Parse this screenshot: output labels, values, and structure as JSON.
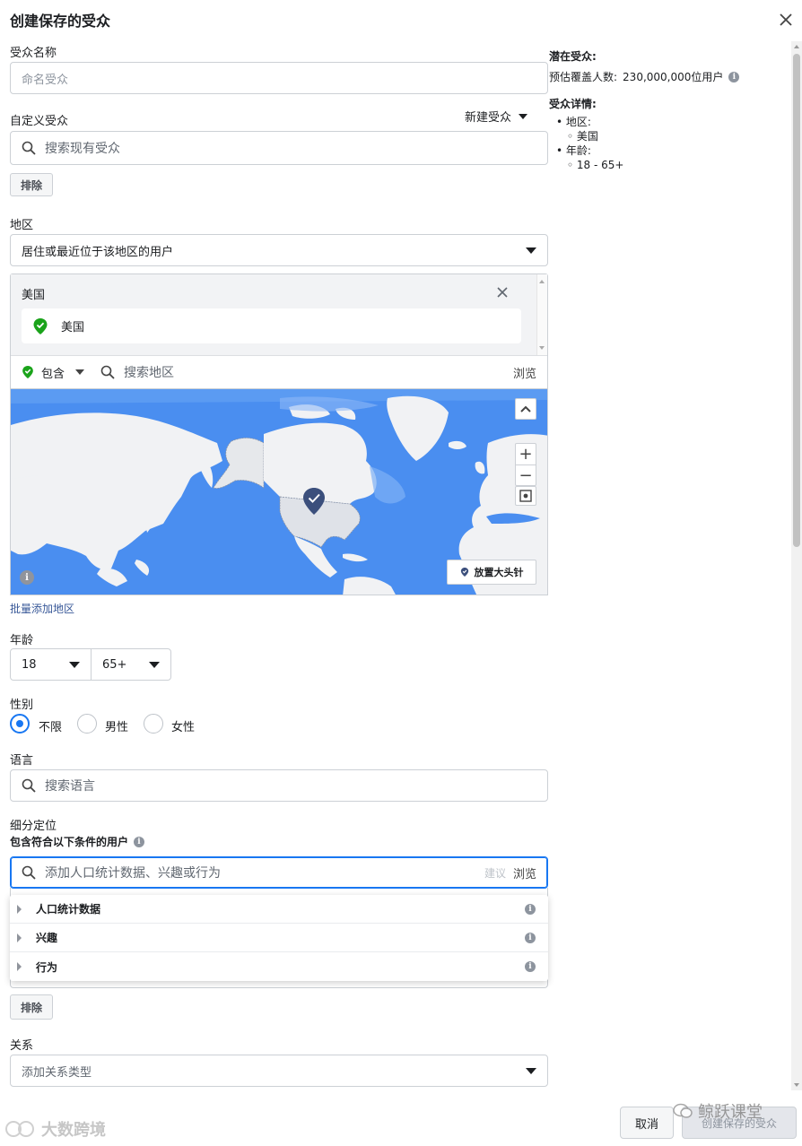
{
  "dialog": {
    "title": "创建保存的受众"
  },
  "audience_name": {
    "label": "受众名称",
    "placeholder": "命名受众"
  },
  "custom_audience": {
    "label": "自定义受众",
    "new_audience": "新建受众",
    "search_placeholder": "搜索现有受众",
    "exclude": "排除"
  },
  "location": {
    "label": "地区",
    "mode_select": "居住或最近位于该地区的用户",
    "group_title": "美国",
    "selected_item": "美国",
    "include_label": "包含",
    "search_placeholder": "搜索地区",
    "browse": "浏览",
    "drop_pin": "放置大头针",
    "bulk_add": "批量添加地区"
  },
  "age": {
    "label": "年龄",
    "min": "18",
    "max": "65+"
  },
  "gender": {
    "label": "性别",
    "options": [
      "不限",
      "男性",
      "女性"
    ],
    "selected": "不限"
  },
  "language": {
    "label": "语言",
    "search_placeholder": "搜索语言"
  },
  "detailed_targeting": {
    "label": "细分定位",
    "include_label": "包含符合以下条件的用户",
    "search_placeholder": "添加人口统计数据、兴趣或行为",
    "suggest": "建议",
    "browse": "浏览",
    "categories": [
      "人口统计数据",
      "兴趣",
      "行为"
    ],
    "exclude": "排除"
  },
  "connections": {
    "label": "关系",
    "placeholder": "添加关系类型"
  },
  "summary": {
    "potential_title": "潜在受众:",
    "reach_label": "预估覆盖人数:",
    "reach_value": "230,000,000位用户",
    "details_title": "受众详情:",
    "location_key": "地区:",
    "location_value": "美国",
    "age_key": "年龄:",
    "age_value": "18 - 65+"
  },
  "footer": {
    "cancel": "取消",
    "create": "创建保存的受众"
  },
  "watermarks": {
    "left": "大数跨境",
    "right": "鲸跃课堂"
  },
  "colors": {
    "accent": "#1877f2",
    "include_green": "#1aa31a",
    "map_ocean": "#4a8ef0",
    "pin": "#3b4f7c"
  }
}
